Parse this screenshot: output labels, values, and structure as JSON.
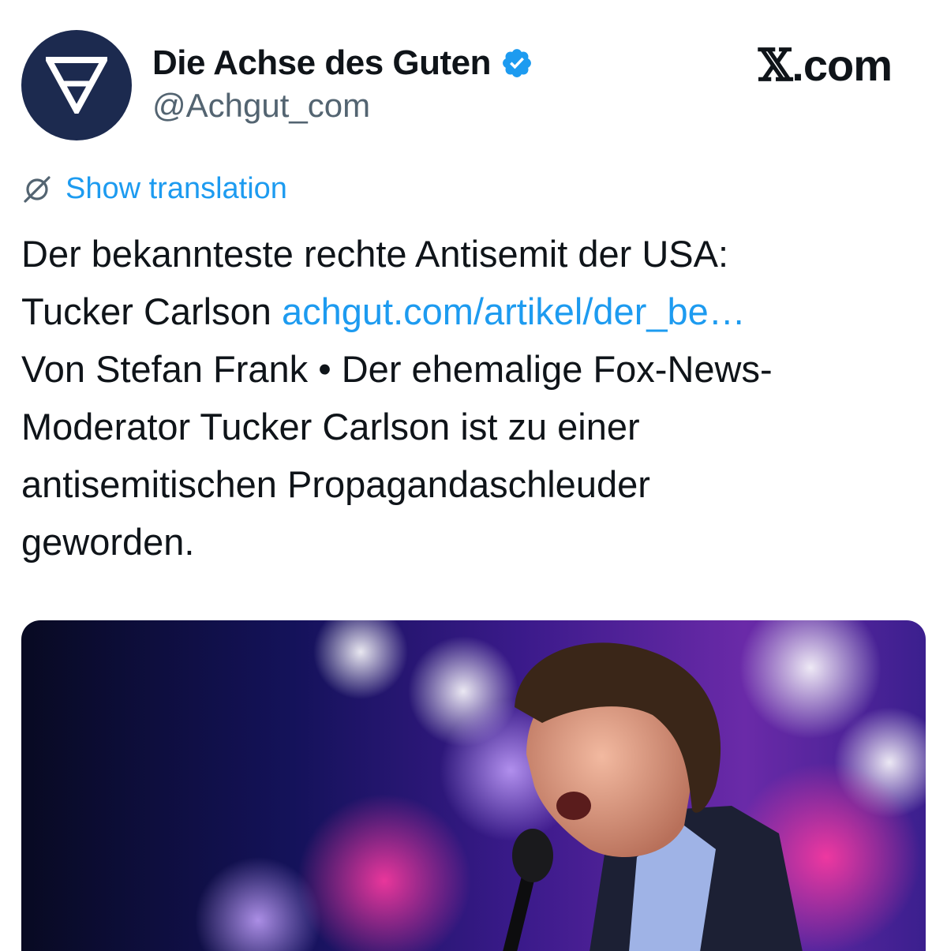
{
  "author": {
    "display_name": "Die Achse des Guten",
    "handle": "@Achgut_com",
    "verified": true,
    "avatar_icon": "achgut-logo-icon"
  },
  "brand": {
    "label": ".com",
    "glyph": "𝕏"
  },
  "translation": {
    "label": "Show translation",
    "icon": "globe-slash-icon"
  },
  "tweet": {
    "line1": "Der bekannteste rechte Antisemit der USA:",
    "line2_text": "Tucker Carlson ",
    "line2_link": "achgut.com/artikel/der_be…",
    "line3": "Von Stefan Frank • Der ehemalige Fox-News-",
    "line4": "Moderator Tucker Carlson ist zu einer",
    "line5": "antisemitischen Propagandaschleuder",
    "line6": "geworden."
  },
  "media": {
    "type": "photo"
  },
  "colors": {
    "link": "#1d9bf0",
    "text": "#0f1419",
    "muted": "#536471",
    "avatar_bg": "#1c2a4f"
  }
}
